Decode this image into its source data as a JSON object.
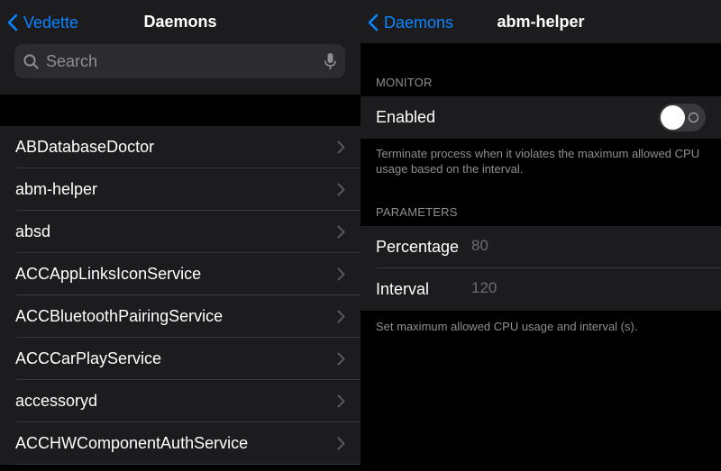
{
  "left": {
    "back_label": "Vedette",
    "title": "Daemons",
    "search": {
      "placeholder": "Search"
    },
    "items": [
      {
        "label": "ABDatabaseDoctor"
      },
      {
        "label": "abm-helper"
      },
      {
        "label": "absd"
      },
      {
        "label": "ACCAppLinksIconService"
      },
      {
        "label": "ACCBluetoothPairingService"
      },
      {
        "label": "ACCCarPlayService"
      },
      {
        "label": "accessoryd"
      },
      {
        "label": "ACCHWComponentAuthService"
      }
    ]
  },
  "right": {
    "back_label": "Daemons",
    "title": "abm-helper",
    "monitor": {
      "header": "MONITOR",
      "enabled_label": "Enabled",
      "enabled": false,
      "footer": "Terminate process when it violates the maximum allowed CPU usage based on the interval."
    },
    "parameters": {
      "header": "PARAMETERS",
      "percentage_label": "Percentage",
      "percentage_placeholder": "80",
      "interval_label": "Interval",
      "interval_placeholder": "120",
      "footer": "Set maximum allowed CPU usage and interval (s)."
    }
  },
  "colors": {
    "accent": "#0a84ff",
    "cell_background": "#1c1c1e",
    "secondary_text": "#8e8e93"
  },
  "icons": {
    "back": "chevron-left-icon",
    "search": "search-icon",
    "mic": "microphone-icon",
    "disclosure": "chevron-right-icon"
  }
}
